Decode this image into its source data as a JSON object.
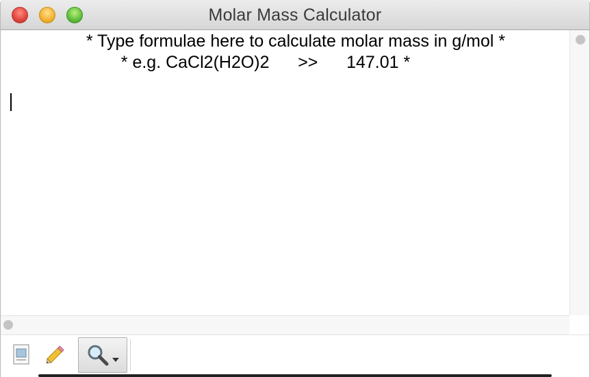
{
  "window": {
    "title": "Molar Mass Calculator"
  },
  "editor": {
    "header_line_1": "* Type formulae here to calculate molar mass in g/mol *",
    "header_line_2": "* e.g. CaCl2(H2O)2      >>      147.01 *",
    "content": ""
  },
  "toolbar": {
    "icons": [
      "document-icon",
      "pencil-icon",
      "search-icon"
    ],
    "search_dropdown": "chevron-down-icon"
  }
}
